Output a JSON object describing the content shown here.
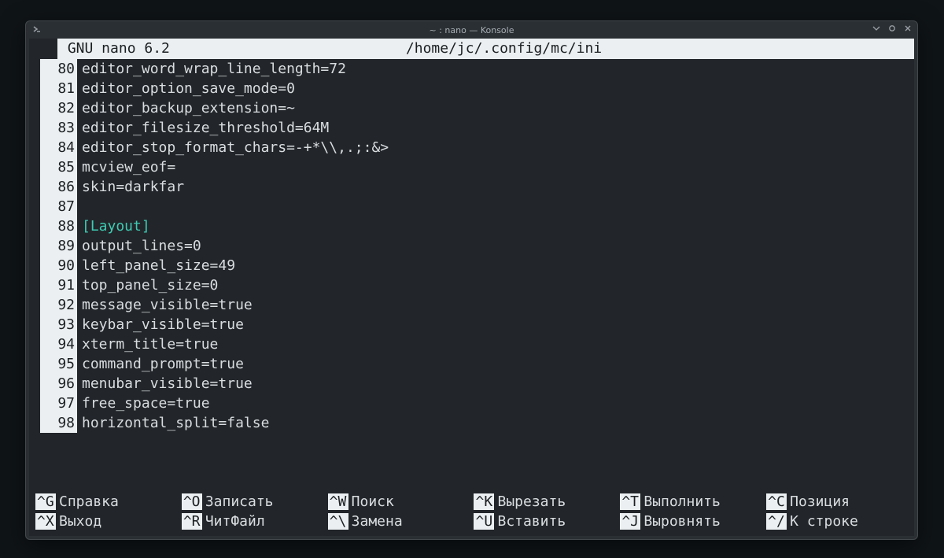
{
  "window": {
    "title": "~ : nano — Konsole"
  },
  "header": {
    "app": " GNU nano 6.2",
    "path": "/home/jc/.config/mc/ini"
  },
  "lines": [
    {
      "n": "80",
      "text": "editor_word_wrap_line_length=72",
      "section": false
    },
    {
      "n": "81",
      "text": "editor_option_save_mode=0",
      "section": false
    },
    {
      "n": "82",
      "text": "editor_backup_extension=~",
      "section": false
    },
    {
      "n": "83",
      "text": "editor_filesize_threshold=64M",
      "section": false
    },
    {
      "n": "84",
      "text": "editor_stop_format_chars=-+*\\\\,.;:&>",
      "section": false
    },
    {
      "n": "85",
      "text": "mcview_eof=",
      "section": false
    },
    {
      "n": "86",
      "text": "skin=darkfar",
      "section": false
    },
    {
      "n": "87",
      "text": "",
      "section": false
    },
    {
      "n": "88",
      "text": "[Layout]",
      "section": true
    },
    {
      "n": "89",
      "text": "output_lines=0",
      "section": false
    },
    {
      "n": "90",
      "text": "left_panel_size=49",
      "section": false
    },
    {
      "n": "91",
      "text": "top_panel_size=0",
      "section": false
    },
    {
      "n": "92",
      "text": "message_visible=true",
      "section": false
    },
    {
      "n": "93",
      "text": "keybar_visible=true",
      "section": false
    },
    {
      "n": "94",
      "text": "xterm_title=true",
      "section": false
    },
    {
      "n": "95",
      "text": "command_prompt=true",
      "section": false
    },
    {
      "n": "96",
      "text": "menubar_visible=true",
      "section": false
    },
    {
      "n": "97",
      "text": "free_space=true",
      "section": false
    },
    {
      "n": "98",
      "text": "horizontal_split=false",
      "section": false
    }
  ],
  "shortcuts": [
    {
      "key": "^G",
      "label": "Справка"
    },
    {
      "key": "^O",
      "label": "Записать"
    },
    {
      "key": "^W",
      "label": "Поиск"
    },
    {
      "key": "^K",
      "label": "Вырезать"
    },
    {
      "key": "^T",
      "label": "Выполнить"
    },
    {
      "key": "^C",
      "label": "Позиция"
    },
    {
      "key": "^X",
      "label": "Выход"
    },
    {
      "key": "^R",
      "label": "ЧитФайл"
    },
    {
      "key": "^\\",
      "label": "Замена"
    },
    {
      "key": "^U",
      "label": "Вставить"
    },
    {
      "key": "^J",
      "label": "Выровнять"
    },
    {
      "key": "^/",
      "label": "К строке"
    }
  ]
}
